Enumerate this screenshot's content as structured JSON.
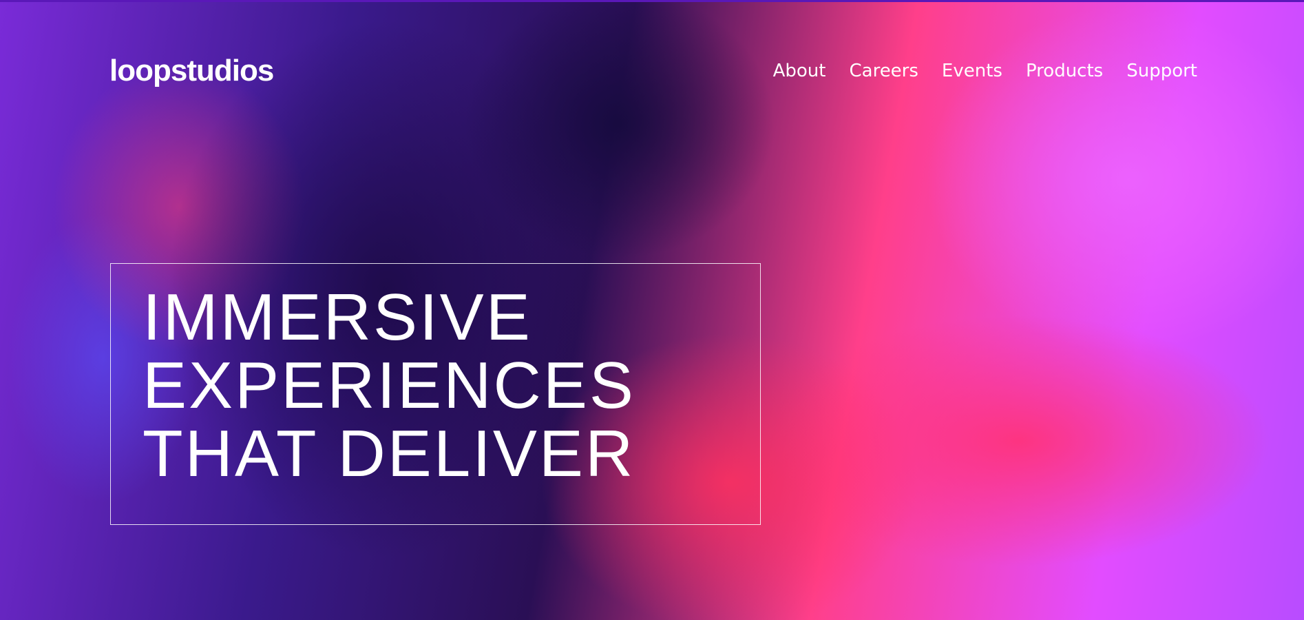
{
  "header": {
    "logo": "loopstudios",
    "nav": [
      "About",
      "Careers",
      "Events",
      "Products",
      "Support"
    ]
  },
  "hero": {
    "headline_lines": [
      "IMMERSIVE",
      "EXPERIENCES",
      "THAT DELIVER"
    ]
  },
  "colors": {
    "text": "#ffffff",
    "accent_magenta": "#e24cff",
    "accent_pink": "#ff3f8a",
    "deep_purple": "#2a0f55"
  }
}
